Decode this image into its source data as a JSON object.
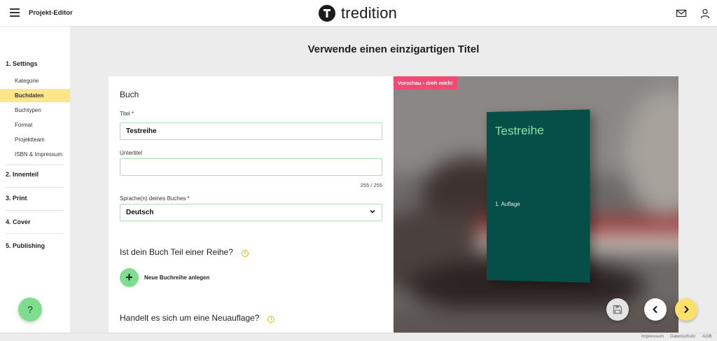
{
  "header": {
    "app_title": "Projekt-Editor",
    "logo_text": "tredition",
    "icons": [
      "menu-icon",
      "mail-icon",
      "user-icon"
    ]
  },
  "sidebar": {
    "sections": [
      {
        "label": "1. Settings",
        "items": [
          "Kategorie",
          "Buchdaten",
          "Buchtypen",
          "Format",
          "Projektteam",
          "ISBN & Impressum"
        ],
        "active": "Buchdaten"
      },
      {
        "label": "2. Innenteil"
      },
      {
        "label": "3. Print"
      },
      {
        "label": "4. Cover"
      },
      {
        "label": "5. Publishing"
      }
    ],
    "help_label": "?"
  },
  "main": {
    "heading": "Verwende einen einzigartigen Titel",
    "form": {
      "section_title": "Buch",
      "title_label": "Titel *",
      "title_value": "Testreihe",
      "subtitle_label": "Untertitel",
      "subtitle_value": "",
      "subtitle_counter": "255 / 255",
      "language_label": "Sprache(n) deines Buches *",
      "language_value": "Deutsch",
      "series_question": "Ist dein Buch Teil einer Reihe?",
      "add_series_label": "Neue Buchreihe anlegen",
      "reprint_question": "Handelt es sich um eine Neuauflage?"
    },
    "preview": {
      "tag": "Vorschau - dreh mich!",
      "book_title": "Testreihe",
      "edition": "1. Auflage",
      "cover_color": "#064e48",
      "title_color": "#8de4a0"
    }
  },
  "footer": {
    "links": [
      "Impressum",
      "Datenschutz",
      "AGB"
    ]
  },
  "colors": {
    "accent_green": "#7edd8e",
    "highlight_yellow": "#fde68a",
    "tag_pink": "#f24a75",
    "next_button": "#fde16a"
  }
}
